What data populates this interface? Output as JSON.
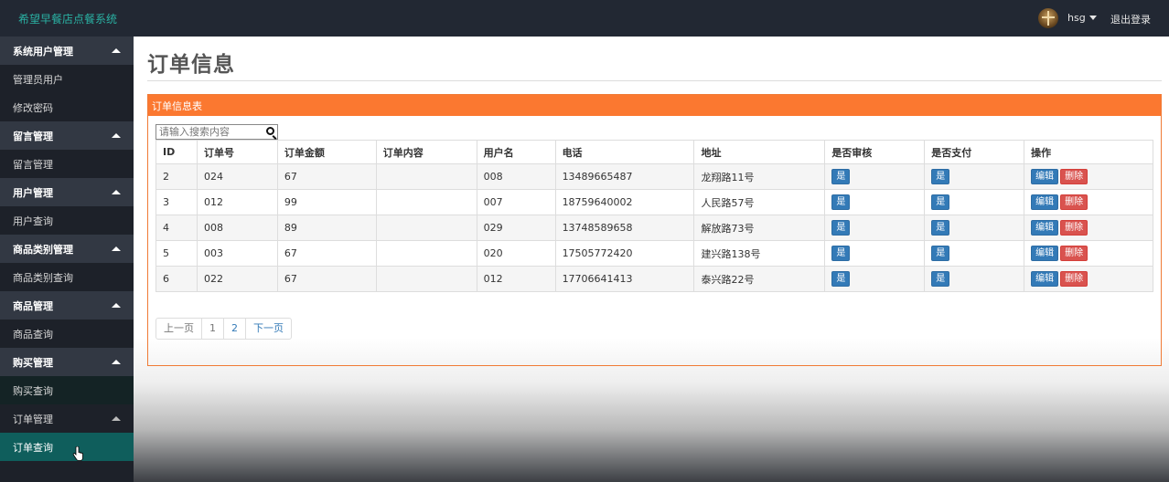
{
  "app": {
    "title": "希望早餐店点餐系统"
  },
  "header": {
    "username": "hsg",
    "logout_label": "退出登录"
  },
  "sidebar": {
    "groups": [
      {
        "label": "系统用户管理",
        "items": [
          "管理员用户",
          "修改密码"
        ]
      },
      {
        "label": "留言管理",
        "items": [
          "留言管理"
        ]
      },
      {
        "label": "用户管理",
        "items": [
          "用户查询"
        ]
      },
      {
        "label": "商品类别管理",
        "items": [
          "商品类别查询"
        ]
      },
      {
        "label": "商品管理",
        "items": [
          "商品查询"
        ]
      },
      {
        "label": "购买管理",
        "items": [
          "购买查询"
        ]
      },
      {
        "label": "订单管理",
        "items": [
          "订单查询"
        ]
      }
    ],
    "active_item": "订单查询"
  },
  "main": {
    "page_title": "订单信息",
    "panel_title": "订单信息表",
    "search_placeholder": "请输入搜索内容",
    "columns": [
      "ID",
      "订单号",
      "订单金额",
      "订单内容",
      "用户名",
      "电话",
      "地址",
      "是否审核",
      "是否支付",
      "操作"
    ],
    "rows": [
      {
        "id": "2",
        "order_no": "024",
        "amount": "67",
        "content": "",
        "user": "008",
        "phone": "13489665487",
        "address": "龙翔路11号",
        "reviewed": "是",
        "paid": "是"
      },
      {
        "id": "3",
        "order_no": "012",
        "amount": "99",
        "content": "",
        "user": "007",
        "phone": "18759640002",
        "address": "人民路57号",
        "reviewed": "是",
        "paid": "是"
      },
      {
        "id": "4",
        "order_no": "008",
        "amount": "89",
        "content": "",
        "user": "029",
        "phone": "13748589658",
        "address": "解放路73号",
        "reviewed": "是",
        "paid": "是"
      },
      {
        "id": "5",
        "order_no": "003",
        "amount": "67",
        "content": "",
        "user": "020",
        "phone": "17505772420",
        "address": "建兴路138号",
        "reviewed": "是",
        "paid": "是"
      },
      {
        "id": "6",
        "order_no": "022",
        "amount": "67",
        "content": "",
        "user": "012",
        "phone": "17706641413",
        "address": "泰兴路22号",
        "reviewed": "是",
        "paid": "是"
      }
    ],
    "edit_label": "编辑",
    "delete_label": "删除",
    "pagination": {
      "prev": "上一页",
      "pages": [
        "1",
        "2"
      ],
      "next": "下一页"
    }
  }
}
